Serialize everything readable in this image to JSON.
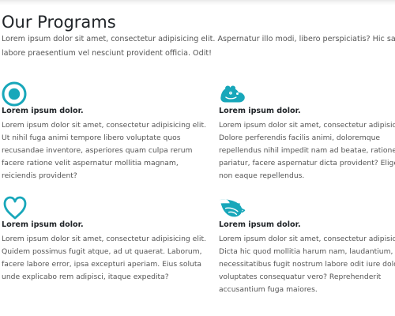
{
  "page": {
    "title": "Our Programs",
    "intro": "Lorem ipsum dolor sit amet, consectetur adipisicing elit. Aspernatur illo modi, libero perspiciatis? Hic sapiente labore praesentium vel nesciunt provident officia. Odit!",
    "accent_color": "#18a7ba"
  },
  "programs": [
    {
      "icon": "target-icon",
      "title": "Lorem ipsum dolor.",
      "text": "Lorem ipsum dolor sit amet, consectetur adipisicing elit. Ut nihil fuga animi tempore libero voluptate quos recusandae inventore, asperiores quam culpa rerum facere ratione velit aspernatur mollitia magnam, reiciendis provident?"
    },
    {
      "icon": "hippo-icon",
      "title": "Lorem ipsum dolor.",
      "text": "Lorem ipsum dolor sit amet, consectetur adipisicing elit. Dolore perferendis facilis animi, doloremque repellendus nihil impedit nam ad beatae, ratione pariatur, facere aspernatur dicta provident? Eligendi ab non eaque repellendus."
    },
    {
      "icon": "heart-outline-icon",
      "title": "Lorem ipsum dolor.",
      "text": "Lorem ipsum dolor sit amet, consectetur adipisicing elit. Quidem possimus fugit atque, ad ut quaerat. Laborum, facere labore error, ipsa excepturi aperiam. Eius soluta unde explicabo rem adipisci, itaque expedita?"
    },
    {
      "icon": "shrimp-icon",
      "title": "Lorem ipsum dolor.",
      "text": "Lorem ipsum dolor sit amet, consectetur adipisicing elit. Dicta hic quod mollitia harum nam, laudantium, necessitatibus fugit nostrum labore odit iure doloribus voluptates consequatur vero? Reprehenderit accusantium fuga maiores."
    }
  ]
}
